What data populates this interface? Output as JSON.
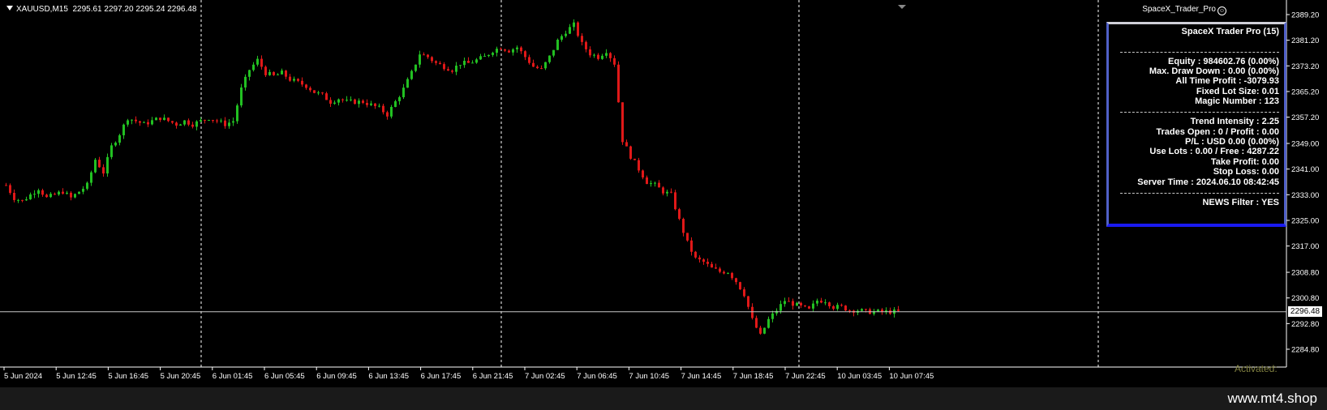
{
  "symbol": {
    "name": "XAUUSD,M15",
    "ohlc": "2295.61 2297.20 2295.24 2296.48"
  },
  "ea_label": "SpaceX_Trader_Pro",
  "ea_smile": "☺",
  "current_price_tag": "2296.48",
  "activated_text": "Activated:",
  "brand": "www.mt4.shop",
  "colors": {
    "background": "#000000",
    "bull": "#22c022",
    "bear": "#e01818",
    "grid": "#ffffff",
    "panel_border": "#1a1af0"
  },
  "panel": {
    "title": "SpaceX Trader Pro (15)",
    "lines": [
      "Equity : 984602.76 (0.00%)",
      "Max. Draw Down : 0.00 (0.00%)",
      "All Time Profit : -3079.93",
      "Fixed Lot Size: 0.01",
      "Magic Number : 123",
      "Trend Intensity : 2.25",
      "Trades Open : 0 / Profit : 0.00",
      "P/L : USD 0.00 (0.00%)",
      "Use Lots : 0.00 / Free : 4287.22",
      "Take Profit: 0.00",
      "Stop Loss: 0.00",
      "Server Time : 2024.06.10 08:42:45",
      "NEWS Filter : YES"
    ]
  },
  "chart_data": {
    "type": "candlestick",
    "y_ticks": [
      "2389.20",
      "2381.20",
      "2373.20",
      "2365.20",
      "2357.20",
      "2349.00",
      "2341.00",
      "2333.00",
      "2325.00",
      "2317.00",
      "2308.80",
      "2300.80",
      "2292.80",
      "2284.80"
    ],
    "ylim": [
      2284.8,
      2389.2
    ],
    "x_labels": [
      "5 Jun 2024",
      "5 Jun 12:45",
      "5 Jun 16:45",
      "5 Jun 20:45",
      "6 Jun 01:45",
      "6 Jun 05:45",
      "6 Jun 09:45",
      "6 Jun 13:45",
      "6 Jun 17:45",
      "6 Jun 21:45",
      "7 Jun 02:45",
      "7 Jun 06:45",
      "7 Jun 10:45",
      "7 Jun 14:45",
      "7 Jun 18:45",
      "7 Jun 22:45",
      "10 Jun 03:45",
      "10 Jun 07:45"
    ],
    "current_price": 2296.48,
    "price_path": [
      [
        0,
        2336
      ],
      [
        10,
        2332
      ],
      [
        20,
        2331
      ],
      [
        30,
        2333
      ],
      [
        40,
        2335
      ],
      [
        50,
        2332
      ],
      [
        60,
        2333
      ],
      [
        70,
        2334
      ],
      [
        80,
        2332
      ],
      [
        90,
        2334
      ],
      [
        100,
        2336
      ],
      [
        110,
        2344
      ],
      [
        120,
        2340
      ],
      [
        130,
        2348
      ],
      [
        140,
        2352
      ],
      [
        150,
        2357
      ],
      [
        160,
        2356
      ],
      [
        170,
        2355
      ],
      [
        180,
        2356
      ],
      [
        190,
        2357
      ],
      [
        200,
        2356
      ],
      [
        210,
        2355
      ],
      [
        220,
        2356
      ],
      [
        230,
        2355
      ],
      [
        240,
        2356
      ],
      [
        250,
        2357
      ],
      [
        260,
        2356
      ],
      [
        270,
        2355
      ],
      [
        280,
        2356
      ],
      [
        290,
        2366
      ],
      [
        300,
        2372
      ],
      [
        310,
        2375
      ],
      [
        320,
        2371
      ],
      [
        330,
        2370
      ],
      [
        340,
        2371
      ],
      [
        350,
        2369
      ],
      [
        360,
        2368
      ],
      [
        370,
        2367
      ],
      [
        380,
        2365
      ],
      [
        390,
        2364
      ],
      [
        400,
        2362
      ],
      [
        410,
        2363
      ],
      [
        420,
        2362
      ],
      [
        430,
        2362
      ],
      [
        440,
        2362
      ],
      [
        450,
        2361
      ],
      [
        460,
        2360
      ],
      [
        470,
        2358
      ],
      [
        480,
        2362
      ],
      [
        490,
        2366
      ],
      [
        500,
        2371
      ],
      [
        510,
        2377
      ],
      [
        520,
        2376
      ],
      [
        530,
        2374
      ],
      [
        540,
        2373
      ],
      [
        550,
        2372
      ],
      [
        560,
        2374
      ],
      [
        570,
        2374
      ],
      [
        580,
        2375
      ],
      [
        590,
        2376
      ],
      [
        600,
        2378
      ],
      [
        610,
        2379
      ],
      [
        620,
        2378
      ],
      [
        630,
        2379
      ],
      [
        640,
        2376
      ],
      [
        650,
        2373
      ],
      [
        660,
        2372
      ],
      [
        670,
        2376
      ],
      [
        680,
        2381
      ],
      [
        690,
        2384
      ],
      [
        700,
        2386
      ],
      [
        710,
        2380
      ],
      [
        720,
        2377
      ],
      [
        730,
        2376
      ],
      [
        740,
        2378
      ],
      [
        750,
        2374
      ],
      [
        760,
        2350
      ],
      [
        770,
        2345
      ],
      [
        780,
        2341
      ],
      [
        790,
        2337
      ],
      [
        800,
        2336
      ],
      [
        810,
        2334
      ],
      [
        820,
        2333
      ],
      [
        830,
        2325
      ],
      [
        840,
        2318
      ],
      [
        850,
        2313
      ],
      [
        860,
        2312
      ],
      [
        870,
        2310
      ],
      [
        880,
        2309
      ],
      [
        890,
        2309
      ],
      [
        900,
        2306
      ],
      [
        910,
        2302
      ],
      [
        920,
        2294
      ],
      [
        930,
        2289
      ],
      [
        940,
        2294
      ],
      [
        950,
        2297
      ],
      [
        960,
        2300
      ],
      [
        970,
        2299
      ],
      [
        980,
        2298
      ],
      [
        990,
        2297
      ],
      [
        1000,
        2300
      ],
      [
        1010,
        2300
      ],
      [
        1020,
        2298
      ],
      [
        1030,
        2298
      ],
      [
        1040,
        2297
      ],
      [
        1050,
        2297
      ],
      [
        1060,
        2296.5
      ]
    ]
  }
}
